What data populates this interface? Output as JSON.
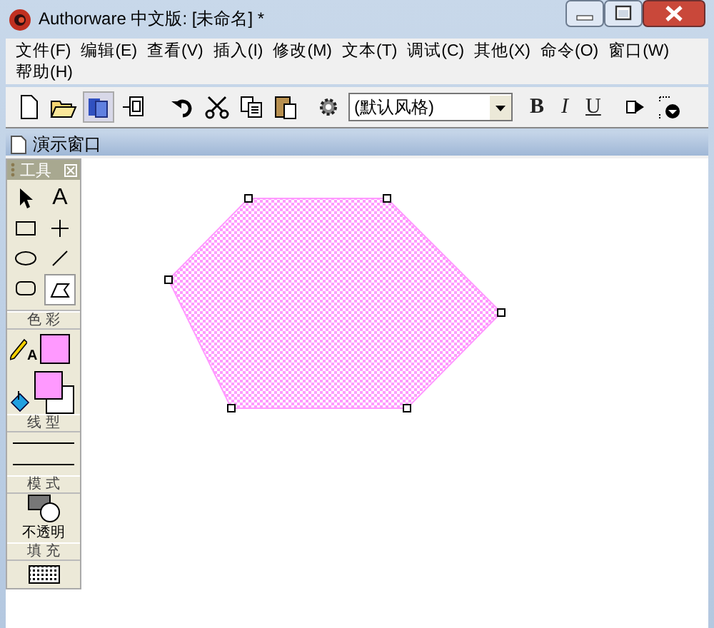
{
  "window": {
    "title": "Authorware 中文版: [未命名] *"
  },
  "menu": [
    "文件(F)",
    "编辑(E)",
    "查看(V)",
    "插入(I)",
    "修改(M)",
    "文本(T)",
    "调试(C)",
    "其他(X)",
    "命令(O)",
    "窗口(W)",
    "帮助(H)"
  ],
  "toolbar": {
    "style_dropdown": {
      "value": "(默认风格)"
    },
    "text_buttons": [
      {
        "kind": "bold",
        "label": "B"
      },
      {
        "kind": "italic",
        "label": "I"
      },
      {
        "kind": "underline",
        "label": "U"
      }
    ]
  },
  "presentation_window": {
    "title": "演示窗口"
  },
  "toolbox": {
    "title": "工具",
    "tools": [
      {
        "kind": "pointer",
        "selected": false
      },
      {
        "kind": "text",
        "label": "A",
        "selected": false
      },
      {
        "kind": "rectangle",
        "selected": false
      },
      {
        "kind": "straight-line",
        "selected": false
      },
      {
        "kind": "ellipse",
        "selected": false
      },
      {
        "kind": "diagonal-line",
        "selected": false
      },
      {
        "kind": "rounded-rectangle",
        "selected": false
      },
      {
        "kind": "polygon",
        "selected": true
      }
    ],
    "color_label": "色 彩",
    "line_color_glyph": "A",
    "line_label": "线 型",
    "mode_label": "模 式",
    "mode_name": "不透明",
    "fill_label": "填 充"
  }
}
